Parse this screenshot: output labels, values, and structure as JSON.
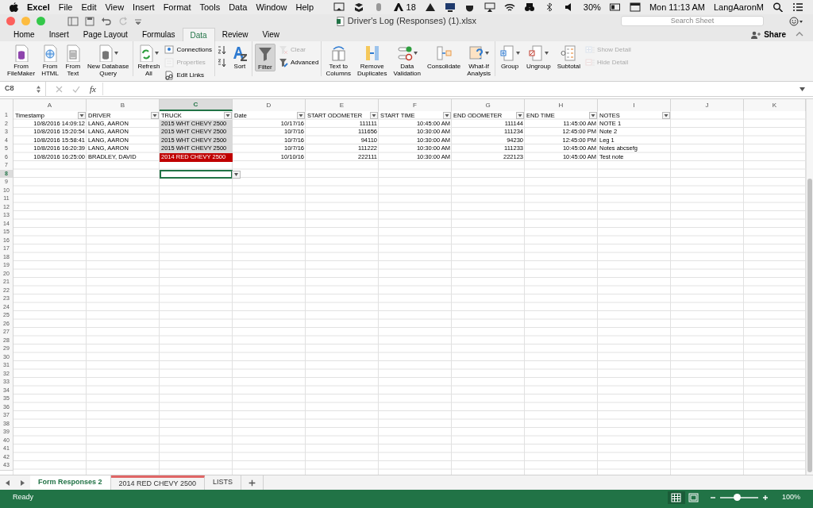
{
  "menu_bar": {
    "app": "Excel",
    "items": [
      "File",
      "Edit",
      "View",
      "Insert",
      "Format",
      "Tools",
      "Data",
      "Window",
      "Help"
    ],
    "notification_count": "18",
    "battery": "30%",
    "clock": "Mon 11:13 AM",
    "user": "LangAaronM"
  },
  "window": {
    "title": "Driver's Log (Responses) (1).xlsx",
    "search": {
      "placeholder": "Search Sheet"
    }
  },
  "tabs": [
    {
      "label": "Home",
      "selected": false
    },
    {
      "label": "Insert",
      "selected": false
    },
    {
      "label": "Page Layout",
      "selected": false
    },
    {
      "label": "Formulas",
      "selected": false
    },
    {
      "label": "Data",
      "selected": true
    },
    {
      "label": "Review",
      "selected": false
    },
    {
      "label": "View",
      "selected": false
    }
  ],
  "share": "Share",
  "ribbon_groups": [
    {
      "items": [
        {
          "kind": "large",
          "lines": [
            "From",
            "FileMaker"
          ],
          "dropdown": false
        },
        {
          "kind": "large",
          "lines": [
            "From",
            "HTML"
          ],
          "dropdown": false
        },
        {
          "kind": "large",
          "lines": [
            "From",
            "Text"
          ],
          "dropdown": false
        },
        {
          "kind": "large",
          "lines": [
            "New Database",
            "Query"
          ],
          "dropdown": true
        }
      ]
    },
    {
      "items": [
        {
          "kind": "large",
          "lines": [
            "Refresh",
            "All"
          ],
          "dropdown": true
        },
        {
          "kind": "stack",
          "buttons": [
            {
              "label": "Connections",
              "disabled": false
            },
            {
              "label": "Properties",
              "disabled": true
            },
            {
              "label": "Edit Links",
              "disabled": false
            }
          ]
        }
      ]
    },
    {
      "items": [
        {
          "kind": "stack",
          "buttons": [
            {
              "disabled": false
            },
            {
              "disabled": false
            }
          ]
        },
        {
          "kind": "large",
          "lines": [
            "Sort"
          ],
          "dropdown": false
        }
      ]
    },
    {
      "items": [
        {
          "kind": "large",
          "lines": [
            "Filter"
          ],
          "dropdown": false,
          "pressed": true
        },
        {
          "kind": "stack",
          "buttons": [
            {
              "label": "Clear",
              "disabled": true
            },
            {
              "label": "Advanced",
              "disabled": false
            }
          ]
        }
      ]
    },
    {
      "items": [
        {
          "kind": "large",
          "lines": [
            "Text to",
            "Columns"
          ],
          "dropdown": false
        },
        {
          "kind": "large",
          "lines": [
            "Remove",
            "Duplicates"
          ],
          "dropdown": false
        },
        {
          "kind": "large",
          "lines": [
            "Data",
            "Validation"
          ],
          "dropdown": true
        },
        {
          "kind": "large",
          "lines": [
            "Consolidate"
          ],
          "dropdown": false
        },
        {
          "kind": "large",
          "lines": [
            "What-If",
            "Analysis"
          ],
          "dropdown": true
        }
      ]
    },
    {
      "items": [
        {
          "kind": "large",
          "lines": [
            "Group"
          ],
          "dropdown": true
        },
        {
          "kind": "large",
          "lines": [
            "Ungroup"
          ],
          "dropdown": true
        },
        {
          "kind": "large",
          "lines": [
            "Subtotal"
          ],
          "dropdown": false
        },
        {
          "kind": "stack",
          "buttons": [
            {
              "label": "Show Detail",
              "disabled": true
            },
            {
              "label": "Hide Detail",
              "disabled": true
            }
          ]
        }
      ]
    }
  ],
  "formula_bar": {
    "name_box": "C8",
    "function_label": "fx"
  },
  "sheet": {
    "columns": [
      {
        "label": "A",
        "selected": false
      },
      {
        "label": "B",
        "selected": false
      },
      {
        "label": "C",
        "selected": true
      },
      {
        "label": "D",
        "selected": false
      },
      {
        "label": "E",
        "selected": false
      },
      {
        "label": "F",
        "selected": false
      },
      {
        "label": "G",
        "selected": false
      },
      {
        "label": "H",
        "selected": false
      },
      {
        "label": "I",
        "selected": false
      },
      {
        "label": "J",
        "selected": false
      },
      {
        "label": "K",
        "selected": false
      }
    ],
    "header_row": {
      "number": "1",
      "cells": [
        "Timestamp",
        "DRIVER",
        "TRUCK",
        "Date",
        "START ODOMETER",
        "START TIME",
        "END ODOMETER",
        "END TIME",
        "NOTES"
      ]
    },
    "rows": [
      {
        "number": "2",
        "color": "#d9d9d9",
        "cells": [
          "10/8/2016 14:09:12",
          "LANG, AARON",
          "2015 WHT CHEVY 2500",
          "10/17/16",
          "111111",
          "10:45:00 AM",
          "111144",
          "11:45:00 AM",
          "NOTE 1"
        ]
      },
      {
        "number": "3",
        "color": "#d9d9d9",
        "cells": [
          "10/8/2016 15:20:54",
          "LANG, AARON",
          "2015 WHT CHEVY 2500",
          "10/7/16",
          "111656",
          "10:30:00 AM",
          "111234",
          "12:45:00 PM",
          "Note 2"
        ]
      },
      {
        "number": "4",
        "color": "#d9d9d9",
        "cells": [
          "10/8/2016 15:58:41",
          "LANG, AARON",
          "2015 WHT CHEVY 2500",
          "10/7/16",
          "94110",
          "10:30:00 AM",
          "94230",
          "12:45:00 PM",
          "Leg 1"
        ]
      },
      {
        "number": "5",
        "color": "#d9d9d9",
        "cells": [
          "10/8/2016 16:20:39",
          "LANG, AARON",
          "2015 WHT CHEVY 2500",
          "10/7/16",
          "111222",
          "10:30:00 AM",
          "111233",
          "10:45:00 AM",
          "Notes abcsefg"
        ]
      },
      {
        "number": "6",
        "color": "#c00000",
        "cells": [
          "10/8/2016 16:25:00",
          "BRADLEY, DAVID",
          "2014 RED CHEVY 2500",
          "10/10/16",
          "222111",
          "10:30:00 AM",
          "222123",
          "10:45:00 AM",
          "Test note"
        ]
      }
    ],
    "empty_rows": [
      {
        "number": "7",
        "selected": false
      },
      {
        "number": "8",
        "selected": true
      },
      {
        "number": "9",
        "selected": false
      },
      {
        "number": "10",
        "selected": false
      },
      {
        "number": "11",
        "selected": false
      },
      {
        "number": "12",
        "selected": false
      },
      {
        "number": "13",
        "selected": false
      },
      {
        "number": "14",
        "selected": false
      },
      {
        "number": "15",
        "selected": false
      },
      {
        "number": "16",
        "selected": false
      },
      {
        "number": "17",
        "selected": false
      },
      {
        "number": "18",
        "selected": false
      },
      {
        "number": "19",
        "selected": false
      },
      {
        "number": "20",
        "selected": false
      },
      {
        "number": "21",
        "selected": false
      },
      {
        "number": "22",
        "selected": false
      },
      {
        "number": "23",
        "selected": false
      },
      {
        "number": "24",
        "selected": false
      },
      {
        "number": "25",
        "selected": false
      },
      {
        "number": "26",
        "selected": false
      },
      {
        "number": "27",
        "selected": false
      },
      {
        "number": "28",
        "selected": false
      },
      {
        "number": "29",
        "selected": false
      },
      {
        "number": "30",
        "selected": false
      },
      {
        "number": "31",
        "selected": false
      },
      {
        "number": "32",
        "selected": false
      },
      {
        "number": "33",
        "selected": false
      },
      {
        "number": "34",
        "selected": false
      },
      {
        "number": "35",
        "selected": false
      },
      {
        "number": "36",
        "selected": false
      },
      {
        "number": "37",
        "selected": false
      },
      {
        "number": "38",
        "selected": false
      },
      {
        "number": "39",
        "selected": false
      },
      {
        "number": "40",
        "selected": false
      },
      {
        "number": "41",
        "selected": false
      },
      {
        "number": "42",
        "selected": false
      },
      {
        "number": "43",
        "selected": false
      }
    ]
  },
  "sheet_tabs": [
    {
      "label": "Form Responses 2",
      "selected": true
    },
    {
      "label": "2014 RED CHEVY 2500",
      "selected": false,
      "color": "#e06666"
    },
    {
      "label": "LISTS",
      "selected": false
    }
  ],
  "status_bar": {
    "status": "Ready",
    "zoom": {
      "level": 0.45,
      "reading": "100%"
    }
  }
}
